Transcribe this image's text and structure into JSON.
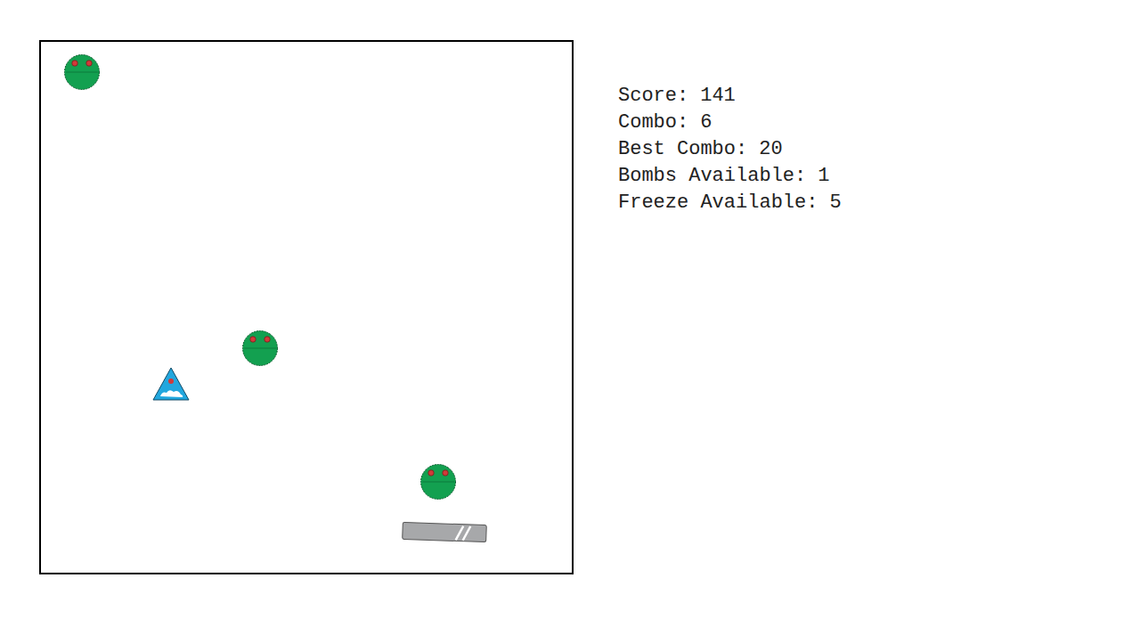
{
  "game": {
    "entities": [
      {
        "kind": "enemy"
      },
      {
        "kind": "enemy"
      },
      {
        "kind": "powerup"
      },
      {
        "kind": "enemy"
      },
      {
        "kind": "paddle"
      }
    ]
  },
  "stats": [
    {
      "label": "Score:",
      "value": "141"
    },
    {
      "label": "Combo:",
      "value": "6"
    },
    {
      "label": "Best Combo:",
      "value": "20"
    },
    {
      "label": "Bombs Available:",
      "value": "1"
    },
    {
      "label": "Freeze Available:",
      "value": "5"
    }
  ]
}
